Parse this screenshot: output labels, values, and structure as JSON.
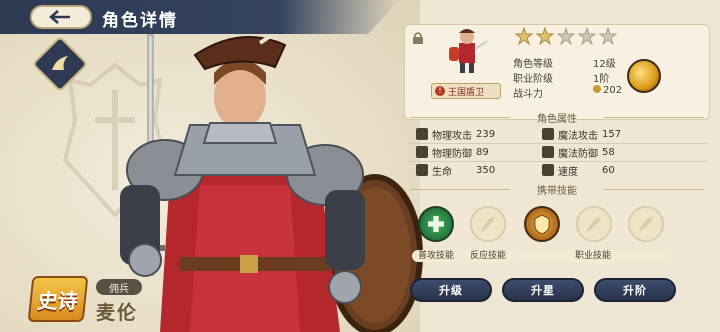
{
  "header": {
    "title": "角色详情"
  },
  "character": {
    "rarity": "史诗",
    "role": "佣兵",
    "name": "麦伦",
    "faction": "王国盾卫",
    "stars_filled": 2,
    "stars_total": 5
  },
  "info": [
    {
      "label": "角色等级",
      "value": "12级"
    },
    {
      "label": "职业阶级",
      "value": "1阶"
    },
    {
      "label": "战斗力",
      "value": "202"
    }
  ],
  "attributes_title": "角色属性",
  "attributes": [
    {
      "label": "物理攻击",
      "value": "239",
      "icon": "sword-icon"
    },
    {
      "label": "魔法攻击",
      "value": "157",
      "icon": "magic-wand-icon"
    },
    {
      "label": "物理防御",
      "value": "89",
      "icon": "shield-icon"
    },
    {
      "label": "魔法防御",
      "value": "58",
      "icon": "magic-shield-icon"
    },
    {
      "label": "生命",
      "value": "350",
      "icon": "heart-icon"
    },
    {
      "label": "速度",
      "value": "60",
      "icon": "boot-icon"
    }
  ],
  "skills_title": "携带技能",
  "skill_labels": {
    "normal": "普攻技能",
    "reaction": "反应技能",
    "class": "职业技能"
  },
  "buttons": {
    "level_up": "升级",
    "star_up": "升星",
    "rank_up": "升阶"
  },
  "colors": {
    "header_bg": "#2d3a52",
    "button_bg": "#2f3d59",
    "panel_bg": "#f8f1e1",
    "rarity_gold": "#e8a52e"
  }
}
